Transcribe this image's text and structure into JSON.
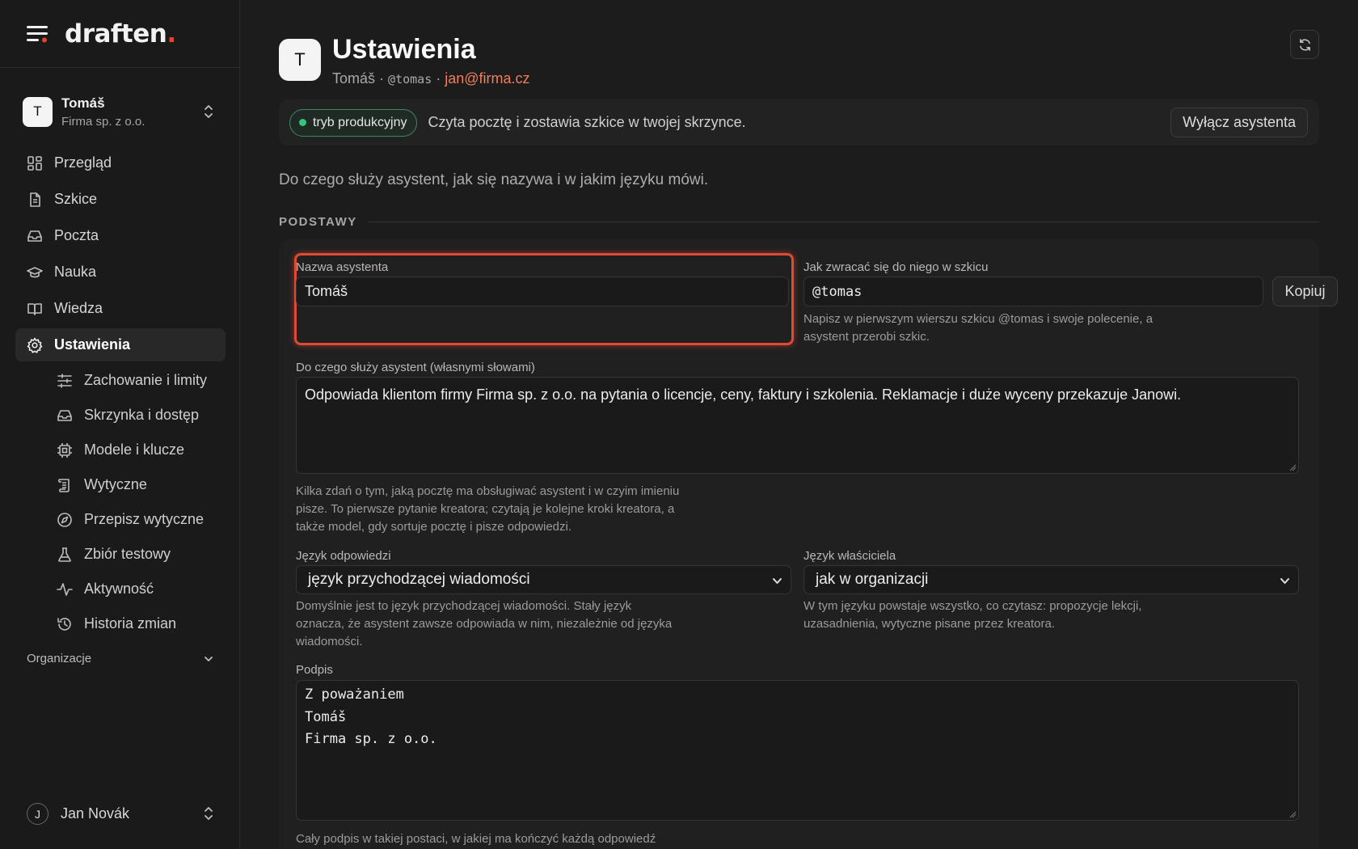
{
  "brand": {
    "logo_text": "draften",
    "logo_dot": ".",
    "accent": "#e4432d"
  },
  "account": {
    "initial": "T",
    "name": "Tomáš",
    "org": "Firma sp. z o.o."
  },
  "nav": {
    "items": [
      {
        "label": "Przegląd",
        "icon": "grid-icon"
      },
      {
        "label": "Szkice",
        "icon": "document-icon"
      },
      {
        "label": "Poczta",
        "icon": "inbox-icon"
      },
      {
        "label": "Nauka",
        "icon": "graduation-cap-icon"
      },
      {
        "label": "Wiedza",
        "icon": "book-icon"
      },
      {
        "label": "Ustawienia",
        "icon": "gear-icon",
        "active": true
      }
    ],
    "sub_items": [
      {
        "label": "Zachowanie i limity",
        "icon": "sliders-icon"
      },
      {
        "label": "Skrzynka i dostęp",
        "icon": "inbox-icon"
      },
      {
        "label": "Modele i klucze",
        "icon": "chip-icon"
      },
      {
        "label": "Wytyczne",
        "icon": "scroll-icon"
      },
      {
        "label": "Przepisz wytyczne",
        "icon": "compass-icon"
      },
      {
        "label": "Zbiór testowy",
        "icon": "flask-icon"
      },
      {
        "label": "Aktywność",
        "icon": "activity-icon"
      },
      {
        "label": "Historia zmian",
        "icon": "history-icon"
      }
    ]
  },
  "org_section": {
    "label": "Organizacje"
  },
  "user": {
    "initial": "J",
    "name": "Jan Novák"
  },
  "header": {
    "initial": "T",
    "title": "Ustawienia",
    "name": "Tomáš",
    "sep1": "·",
    "handle": "@tomas",
    "sep2": "·",
    "email": "jan@firma.cz"
  },
  "status": {
    "badge": "tryb produkcyjny",
    "text": "Czyta pocztę i zostawia szkice w twojej skrzynce.",
    "disable_button": "Wyłącz asystenta",
    "badge_color": "#35c47e"
  },
  "intro": "Do czego służy asystent, jak się nazywa i w jakim języku mówi.",
  "section": {
    "label": "PODSTAWY"
  },
  "form": {
    "name_label": "Nazwa asystenta",
    "name_value": "Tomáš",
    "mention_label": "Jak zwracać się do niego w szkicu",
    "mention_value": "@tomas",
    "copy_button": "Kopiuj",
    "mention_help_1": "Napisz w pierwszym wierszu szkicu @tomas i swoje polecenie, a",
    "mention_help_2": "asystent przerobi szkic.",
    "purpose_label": "Do czego służy asystent (własnymi słowami)",
    "purpose_value": "Odpowiada klientom firmy Firma sp. z o.o. na pytania o licencje, ceny, faktury i szkolenia. Reklamacje i duże wyceny przekazuje Janowi.",
    "purpose_help_1": "Kilka zdań o tym, jaką pocztę ma obsługiwać asystent i w czyim imieniu",
    "purpose_help_2": "pisze. To pierwsze pytanie kreatora; czytają je kolejne kroki kreatora, a",
    "purpose_help_3": "także model, gdy sortuje pocztę i pisze odpowiedzi.",
    "reply_lang_label": "Język odpowiedzi",
    "reply_lang_value": "język przychodzącej wiadomości",
    "reply_lang_help_1": "Domyślnie jest to język przychodzącej wiadomości. Stały język",
    "reply_lang_help_2": "oznacza, że asystent zawsze odpowiada w nim, niezależnie od języka",
    "reply_lang_help_3": "wiadomości.",
    "owner_lang_label": "Język właściciela",
    "owner_lang_value": "jak w organizacji",
    "owner_lang_help_1": "W tym języku powstaje wszystko, co czytasz: propozycje lekcji,",
    "owner_lang_help_2": "uzasadnienia, wytyczne pisane przez kreatora.",
    "signature_label": "Podpis",
    "signature_lines": [
      "Z poważaniem",
      "Tomáš",
      "Firma sp. z o.o."
    ],
    "signature_help": "Cały podpis w takiej postaci, w jakiej ma kończyć każdą odpowiedź"
  }
}
